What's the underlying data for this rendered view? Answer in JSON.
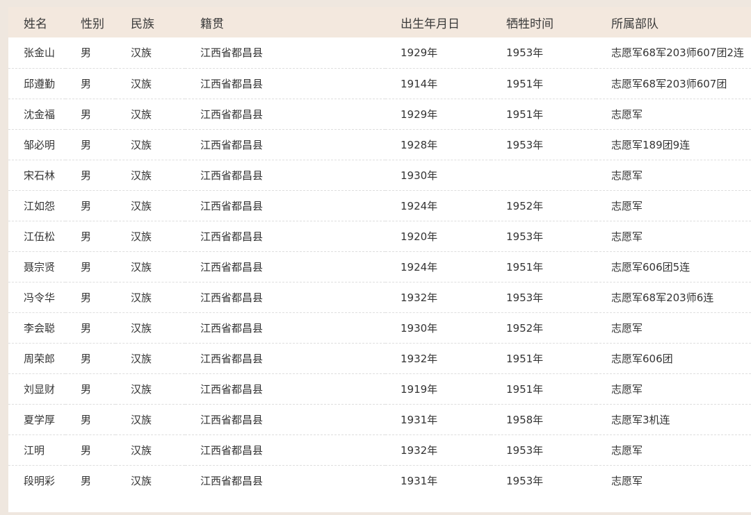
{
  "table": {
    "headers": [
      "姓名",
      "性别",
      "民族",
      "籍贯",
      "出生年月日",
      "牺牲时间",
      "所属部队"
    ],
    "rows": [
      [
        "张金山",
        "男",
        "汉族",
        "江西省都昌县",
        "1929年",
        "1953年",
        "志愿军68军203师607团2连"
      ],
      [
        "邱遵勤",
        "男",
        "汉族",
        "江西省都昌县",
        "1914年",
        "1951年",
        "志愿军68军203师607团"
      ],
      [
        "沈金福",
        "男",
        "汉族",
        "江西省都昌县",
        "1929年",
        "1951年",
        "志愿军"
      ],
      [
        "邹必明",
        "男",
        "汉族",
        "江西省都昌县",
        "1928年",
        "1953年",
        "志愿军189团9连"
      ],
      [
        "宋石林",
        "男",
        "汉族",
        "江西省都昌县",
        "1930年",
        "",
        "志愿军"
      ],
      [
        "江如怨",
        "男",
        "汉族",
        "江西省都昌县",
        "1924年",
        "1952年",
        "志愿军"
      ],
      [
        "江伍松",
        "男",
        "汉族",
        "江西省都昌县",
        "1920年",
        "1953年",
        "志愿军"
      ],
      [
        "聂宗贤",
        "男",
        "汉族",
        "江西省都昌县",
        "1924年",
        "1951年",
        "志愿军606团5连"
      ],
      [
        "冯令华",
        "男",
        "汉族",
        "江西省都昌县",
        "1932年",
        "1953年",
        "志愿军68军203师6连"
      ],
      [
        "李会聪",
        "男",
        "汉族",
        "江西省都昌县",
        "1930年",
        "1952年",
        "志愿军"
      ],
      [
        "周荣郎",
        "男",
        "汉族",
        "江西省都昌县",
        "1932年",
        "1951年",
        "志愿军606团"
      ],
      [
        "刘显财",
        "男",
        "汉族",
        "江西省都昌县",
        "1919年",
        "1951年",
        "志愿军"
      ],
      [
        "夏学厚",
        "男",
        "汉族",
        "江西省都昌县",
        "1931年",
        "1958年",
        "志愿军3机连"
      ],
      [
        "江明",
        "男",
        "汉族",
        "江西省都昌县",
        "1932年",
        "1953年",
        "志愿军"
      ],
      [
        "段明彩",
        "男",
        "汉族",
        "江西省都昌县",
        "1931年",
        "1953年",
        "志愿军"
      ]
    ]
  },
  "colors": {
    "page_background": "#efe7df",
    "header_background": "#f3e8de",
    "panel_background": "#ffffff",
    "text": "#333333",
    "row_divider": "#dedede"
  }
}
